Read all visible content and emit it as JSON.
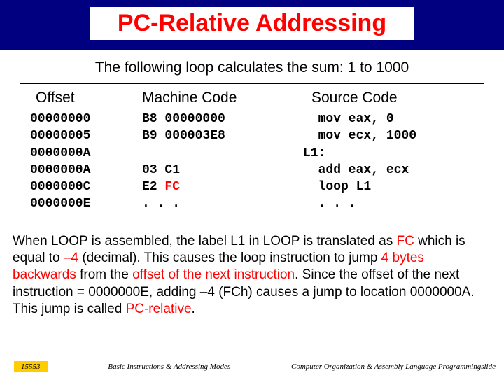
{
  "title": "PC-Relative Addressing",
  "subtitle": "The following loop calculates the sum: 1 to 1000",
  "headers": {
    "offset": "Offset",
    "machine": "Machine Code",
    "source": "Source Code"
  },
  "code": {
    "offsets": [
      "00000000",
      "00000005",
      "0000000A",
      "0000000A",
      "0000000C",
      "0000000E"
    ],
    "machine": [
      {
        "op": "B8",
        "arg": "00000000",
        "hl": false
      },
      {
        "op": "B9",
        "arg": "000003E8",
        "hl": false
      },
      {
        "op": "",
        "arg": "",
        "hl": false
      },
      {
        "op": "03",
        "arg": "C1",
        "hl": false
      },
      {
        "op": "E2",
        "arg": "FC",
        "hl": true
      },
      {
        "op": ".",
        "arg": ". .",
        "hl": false
      }
    ],
    "source": [
      {
        "indent": "  ",
        "text": "mov eax, 0"
      },
      {
        "indent": "  ",
        "text": "mov ecx, 1000"
      },
      {
        "indent": "",
        "text": "L1:"
      },
      {
        "indent": "  ",
        "text": "add eax, ecx"
      },
      {
        "indent": "  ",
        "text": "loop L1"
      },
      {
        "indent": "  ",
        "text": ". . ."
      }
    ]
  },
  "explain": {
    "p1a": "When LOOP is assembled, the label L1 in LOOP is translated as ",
    "p1b": "FC",
    "p1c": " which is equal to ",
    "p1d": "–4",
    "p1e": " (decimal). This causes the loop instruction to jump ",
    "p1f": "4 bytes backwards",
    "p1g": " from the ",
    "p1h": "offset of the next instruction",
    "p1i": ". Since the offset of the next instruction = 0000000E, adding –4 (FCh) causes a jump to location 0000000A. This jump is called ",
    "p1j": "PC-relative",
    "p1k": "."
  },
  "footer": {
    "left": "15553",
    "mid": "Basic Instructions & Addressing Modes",
    "right": "Computer Organization & Assembly Language Programmingslide"
  }
}
